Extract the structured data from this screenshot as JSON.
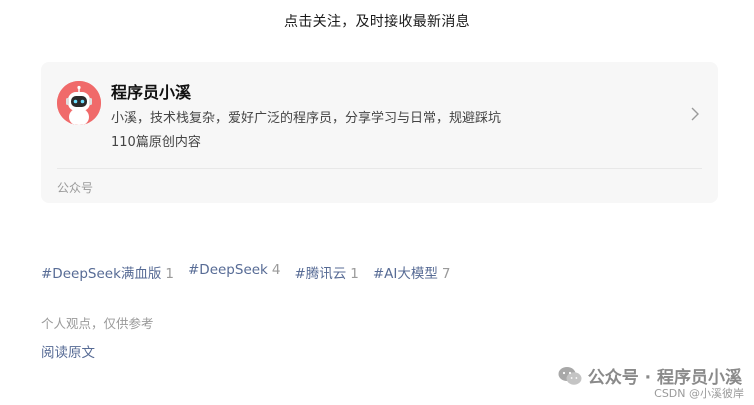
{
  "top_hint": "点击关注，及时接收最新消息",
  "account": {
    "name": "程序员小溪",
    "description": "小溪，技术栈复杂，爱好广泛的程序员，分享学习与日常，规避踩坑",
    "content_count": "110篇原创内容",
    "type": "公众号",
    "avatar_bg": "#f06a6a"
  },
  "tags": [
    {
      "label": "#DeepSeek满血版",
      "count": "1"
    },
    {
      "label": "#DeepSeek",
      "count": "4"
    },
    {
      "label": "#腾讯云",
      "count": "1"
    },
    {
      "label": "#AI大模型",
      "count": "7"
    }
  ],
  "disclaimer": "个人观点，仅供参考",
  "read_original": "阅读原文",
  "watermark": {
    "text": "公众号 · 程序员小溪",
    "csdn": "CSDN @小溪彼岸"
  },
  "colors": {
    "link": "#576b95",
    "muted": "#9a9a9a",
    "card_bg": "#f7f7f7"
  }
}
